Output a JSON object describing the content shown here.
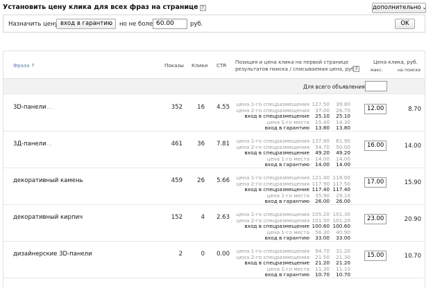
{
  "header": {
    "title": "Установить цену клика для всех фраз на странице",
    "help": "?",
    "advanced_label": "дополнительно"
  },
  "settings": {
    "assign_label": "Назначить цену",
    "mode_value": "вход в гарантию",
    "nomore_label": "но не более",
    "price_value": "60.00",
    "currency_label": "руб.",
    "ok_label": "OK"
  },
  "table": {
    "col_phrase": "Фраза ↑",
    "col_shows": "Показы",
    "col_clicks": "Клики",
    "col_ctr": "CTR",
    "col_position_line1": "Позиция и цена клика на первой странице",
    "col_position_line2": "результатов поиска / списываемая цена, руб.",
    "col_price": "Цена клика, руб.",
    "col_price_max": "макс.",
    "col_price_search": "на поиске",
    "help": "?",
    "all_label": "Для всего объявления:",
    "dots": "…",
    "rows": [
      {
        "phrase": "3D-панели",
        "shows": "352",
        "clicks": "16",
        "ctr": "4.55",
        "positions": [
          {
            "label": "цена 1-го спецразмещения",
            "v1": "127.50",
            "v2": "39.80",
            "dark": false
          },
          {
            "label": "цена 2-го спецразмещения",
            "v1": "37.00",
            "v2": "26.70",
            "dark": false
          },
          {
            "label": "вход в спецразмещение",
            "v1": "25.10",
            "v2": "25.10",
            "dark": true
          },
          {
            "label": "цена 1-го места",
            "v1": "15.40",
            "v2": "14.30",
            "dark": false
          },
          {
            "label": "вход в гарантию",
            "v1": "13.80",
            "v2": "13.80",
            "dark": true
          }
        ],
        "price_max": "12.00",
        "price_search": "8.70"
      },
      {
        "phrase": "3Д-панели",
        "shows": "461",
        "clicks": "36",
        "ctr": "7.81",
        "positions": [
          {
            "label": "цена 1-го спецразмещения",
            "v1": "137.80",
            "v2": "61.90",
            "dark": false
          },
          {
            "label": "цена 2-го спецразмещения",
            "v1": "54.70",
            "v2": "50.00",
            "dark": false
          },
          {
            "label": "вход в спецразмещение",
            "v1": "49.20",
            "v2": "49.20",
            "dark": true
          },
          {
            "label": "цена 1-го места",
            "v1": "14.00",
            "v2": "14.00",
            "dark": false
          },
          {
            "label": "вход в гарантию",
            "v1": "14.00",
            "v2": "14.00",
            "dark": true
          }
        ],
        "price_max": "16.00",
        "price_search": "14.00"
      },
      {
        "phrase": "декоративный камень",
        "shows": "459",
        "clicks": "26",
        "ctr": "5.66",
        "positions": [
          {
            "label": "цена 1-го спецразмещения",
            "v1": "121.40",
            "v2": "118.00",
            "dark": false
          },
          {
            "label": "цена 2-го спецразмещения",
            "v1": "117.90",
            "v2": "117.50",
            "dark": false
          },
          {
            "label": "вход в спецразмещение",
            "v1": "117.40",
            "v2": "117.40",
            "dark": true
          },
          {
            "label": "цена 1-го места",
            "v1": "35.90",
            "v2": "29.10",
            "dark": false
          },
          {
            "label": "вход в гарантию",
            "v1": "26.00",
            "v2": "26.00",
            "dark": true
          }
        ],
        "price_max": "17.00",
        "price_search": "15.90"
      },
      {
        "phrase": "декоративный кирпич",
        "shows": "152",
        "clicks": "4",
        "ctr": "2.63",
        "positions": [
          {
            "label": "цена 1-го спецразмещения",
            "v1": "105.20",
            "v2": "101.30",
            "dark": false
          },
          {
            "label": "цена 2-го спецразмещения",
            "v1": "101.50",
            "v2": "101.20",
            "dark": false
          },
          {
            "label": "вход в спецразмещение",
            "v1": "100.60",
            "v2": "100.60",
            "dark": true
          },
          {
            "label": "цена 1-го места",
            "v1": "56.30",
            "v2": "40.90",
            "dark": false
          },
          {
            "label": "вход в гарантию",
            "v1": "33.00",
            "v2": "33.00",
            "dark": true
          }
        ],
        "price_max": "23.00",
        "price_search": "20.90"
      },
      {
        "phrase": "дизайнерские 3D-панели",
        "shows": "2",
        "clicks": "0",
        "ctr": "0.00",
        "positions": [
          {
            "label": "цена 1-го спецразмещения",
            "v1": "94.70",
            "v2": "31.20",
            "dark": false
          },
          {
            "label": "цена 2-го спецразмещения",
            "v1": "21.50",
            "v2": "21.30",
            "dark": false
          },
          {
            "label": "вход в спецразмещение",
            "v1": "21.20",
            "v2": "21.20",
            "dark": true
          },
          {
            "label": "цена 1-го места",
            "v1": "11.30",
            "v2": "11.10",
            "dark": false
          },
          {
            "label": "вход в гарантию",
            "v1": "10.70",
            "v2": "10.70",
            "dark": true
          }
        ],
        "price_max": "15.00",
        "price_search": "10.70"
      }
    ]
  }
}
